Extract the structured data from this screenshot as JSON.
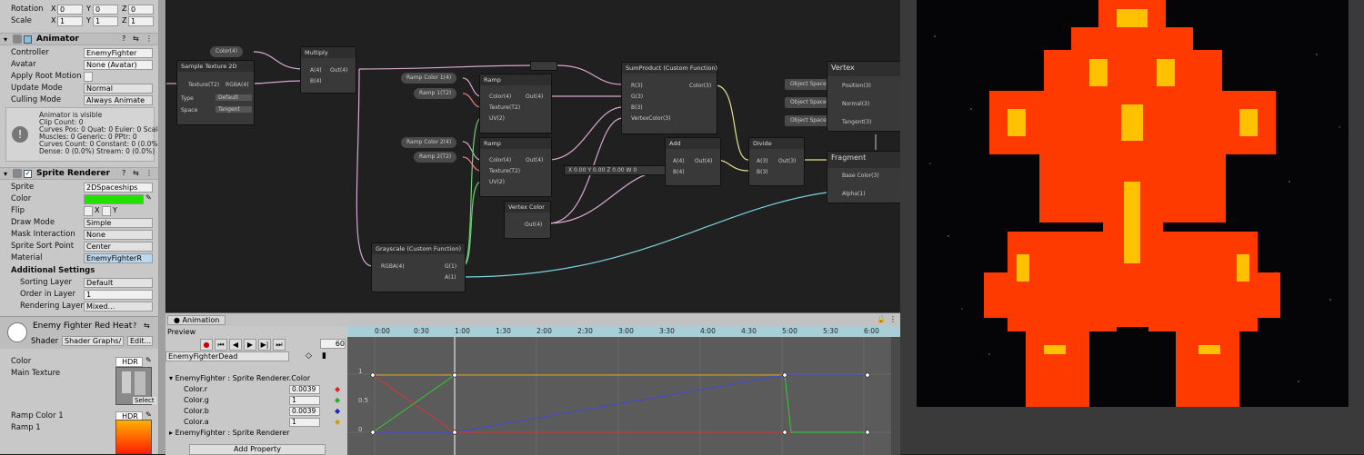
{
  "transform": {
    "rotation_label": "Rotation",
    "scale_label": "Scale",
    "rotation": {
      "x": "0",
      "y": "0",
      "z": "0"
    },
    "scale": {
      "x": "1",
      "y": "1",
      "z": "1"
    }
  },
  "animator": {
    "title": "Animator",
    "controller_label": "Controller",
    "controller_value": "EnemyFighter",
    "avatar_label": "Avatar",
    "avatar_value": "None (Avatar)",
    "apply_root_label": "Apply Root Motion",
    "update_mode_label": "Update Mode",
    "update_mode_value": "Normal",
    "culling_label": "Culling Mode",
    "culling_value": "Always Animate",
    "info": [
      "Animator is visible",
      "Clip Count: 0",
      "Curves Pos: 0 Quat: 0 Euler: 0 Scale: 0",
      "Muscles: 0 Generic: 0 PPtr: 0",
      "Curves Count: 0 Constant: 0 (0.0%)",
      "Dense: 0 (0.0%) Stream: 0 (0.0%)"
    ]
  },
  "sprite_renderer": {
    "title": "Sprite Renderer",
    "sprite_label": "Sprite",
    "sprite_value": "2DSpaceships",
    "color_label": "Color",
    "color_hex": "#22e000",
    "flip_label": "Flip",
    "flip_x": "X",
    "flip_y": "Y",
    "draw_mode_label": "Draw Mode",
    "draw_mode_value": "Simple",
    "mask_label": "Mask Interaction",
    "mask_value": "None",
    "sort_point_label": "Sprite Sort Point",
    "sort_point_value": "Center",
    "material_label": "Material",
    "material_value": "EnemyFighterR",
    "additional_title": "Additional Settings",
    "sorting_layer_label": "Sorting Layer",
    "sorting_layer_value": "Default",
    "order_label": "Order in Layer",
    "order_value": "1",
    "rendering_label": "Rendering Layer M",
    "rendering_value": "Mixed..."
  },
  "material": {
    "name": "Enemy Fighter Red Heat",
    "shader_label": "Shader",
    "shader_value": "Shader Graphs/",
    "edit_label": "Edit...",
    "color_label": "Color",
    "hdr": "HDR",
    "main_tex_label": "Main Texture",
    "select_label": "Select",
    "ramp_color_label": "Ramp Color 1",
    "ramp1_label": "Ramp 1"
  },
  "graph": {
    "nodes": {
      "color4": "Color(4)",
      "sample_tex": "Sample Texture 2D",
      "tex_in": "Texture(T2)",
      "rgba_out": "RGBA(4)",
      "type_label": "Type",
      "type_val": "Default",
      "space_label": "Space",
      "space_val": "Tangent",
      "multiply": "Multiply",
      "mul_a": "A(4)",
      "mul_b": "B(4)",
      "mul_out": "Out(4)",
      "ramp_color_pill1": "Ramp Color 1(4)",
      "ramp1_pill": "Ramp 1(T2)",
      "ramp_color_pill2": "Ramp Color 2(4)",
      "ramp2_pill": "Ramp 2(T2)",
      "ramp": "Ramp",
      "ramp_color": "Color(4)",
      "ramp_tex": "Texture(T2)",
      "ramp_uv": "UV(2)",
      "ramp_out": "Out(4)",
      "sumproduct": "SumProduct (Custom Function)",
      "sp_r": "R(3)",
      "sp_g": "G(3)",
      "sp_b": "B(3)",
      "sp_vc": "VertexColor(3)",
      "sp_out": "Color(3)",
      "vertex_color": "Vertex Color",
      "vc_out": "Out(4)",
      "add": "Add",
      "add_a": "A(4)",
      "add_b": "B(4)",
      "add_out": "Out(4)",
      "vec_x": "X",
      "vec_x_v": "0.00",
      "vec_y": "Y",
      "vec_y_v": "0.00",
      "vec_z": "Z",
      "vec_z_v": "0.00",
      "vec_w": "W",
      "vec_w_v": "0",
      "divide": "Divide",
      "div_a": "A(3)",
      "div_b": "B(3)",
      "div_out": "Out(3)",
      "grayscale": "Grayscale (Custom Function)",
      "gs_in": "RGBA(4)",
      "gs_g": "G(1)",
      "gs_a": "A(1)",
      "vertex": "Vertex",
      "object_space": "Object Space",
      "position": "Position(3)",
      "normal": "Normal(3)",
      "tangent": "Tangent(3)",
      "fragment": "Fragment",
      "base_color": "Base Color(3)",
      "alpha": "Alpha(1)"
    }
  },
  "animation": {
    "tab": "Animation",
    "preview": "Preview",
    "frame": "60",
    "clip": "EnemyFighterDead",
    "add_property": "Add Property",
    "properties": [
      {
        "label": "EnemyFighter : Sprite Renderer.Color",
        "value": ""
      },
      {
        "label": "Color.r",
        "value": "0.0039"
      },
      {
        "label": "Color.g",
        "value": "1"
      },
      {
        "label": "Color.b",
        "value": "0.0039"
      },
      {
        "label": "Color.a",
        "value": "1"
      },
      {
        "label": "EnemyFighter : Sprite Renderer",
        "value": ""
      }
    ],
    "ruler": [
      "0:00",
      "0:30",
      "1:00",
      "1:30",
      "2:00",
      "2:30",
      "3:00",
      "3:30",
      "4:00",
      "4:30",
      "5:00",
      "5:30",
      "6:00"
    ],
    "y_labels": [
      "1",
      "0.5",
      "0"
    ]
  }
}
